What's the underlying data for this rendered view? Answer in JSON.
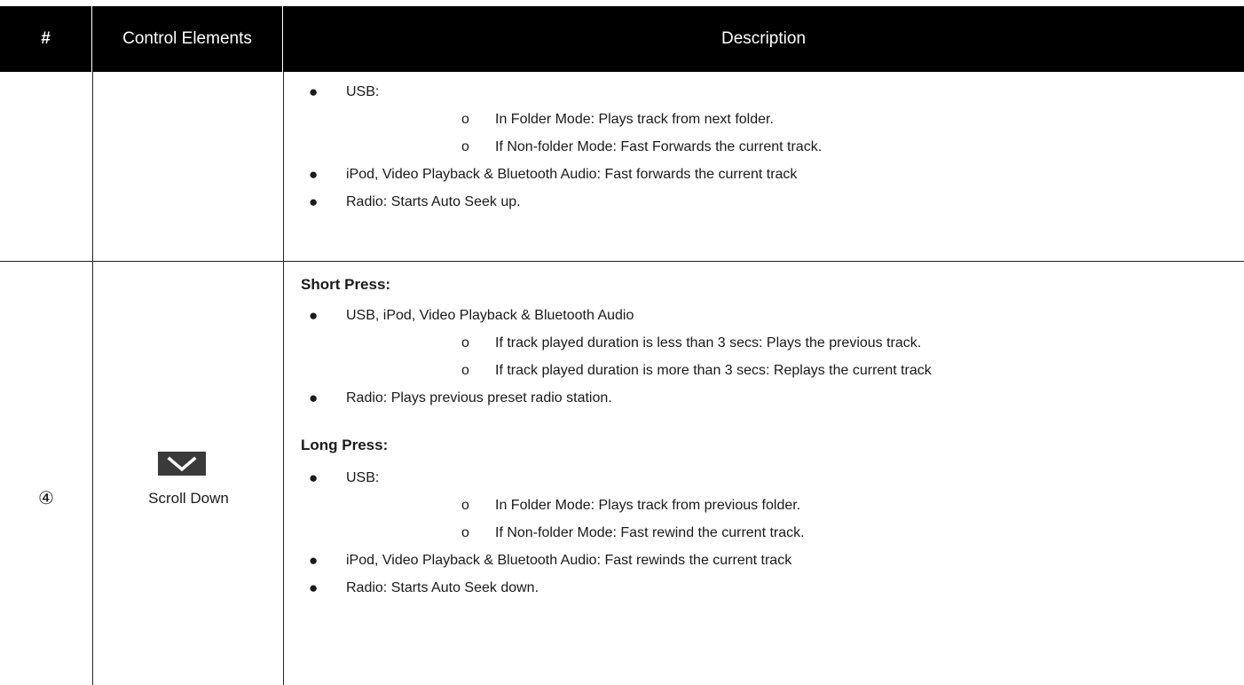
{
  "header": {
    "num": "#",
    "control": "Control Elements",
    "description": "Description"
  },
  "row1": {
    "items": [
      {
        "bullet": "●",
        "text": "USB:"
      },
      {
        "sub": "o",
        "text": "In Folder Mode: Plays track from next folder."
      },
      {
        "sub": "o",
        "text": "If Non-folder Mode: Fast Forwards the current track."
      },
      {
        "bullet": "●",
        "text": "iPod, Video Playback & Bluetooth Audio: Fast forwards the current track"
      },
      {
        "bullet": "●",
        "text": "Radio: Starts Auto Seek up."
      }
    ]
  },
  "row2": {
    "number": "④",
    "control_icon": "chevron-down-icon",
    "control_label": "Scroll Down",
    "short_press_title": "Short Press:",
    "short_press_items": [
      {
        "bullet": "●",
        "text": "USB, iPod, Video Playback & Bluetooth Audio"
      },
      {
        "sub": "o",
        "text": "If track played duration is less than 3 secs: Plays the previous track."
      },
      {
        "sub": "o",
        "text": "If track played duration is more than 3 secs: Replays the current track"
      },
      {
        "bullet": "●",
        "text": "Radio: Plays previous preset radio station."
      }
    ],
    "long_press_title": "Long Press:",
    "long_press_items": [
      {
        "bullet": "●",
        "text": "USB:"
      },
      {
        "sub": "o",
        "text": "In Folder Mode: Plays track from previous folder."
      },
      {
        "sub": "o",
        "text": "If Non-folder Mode: Fast rewind the current track."
      },
      {
        "bullet": "●",
        "text": "iPod, Video Playback & Bluetooth Audio: Fast rewinds the current track"
      },
      {
        "bullet": "●",
        "text": "Radio: Starts Auto Seek down."
      }
    ]
  },
  "colors": {
    "header_bg": "#000000",
    "header_text": "#ffffff",
    "button_bg": "#3a3a3a"
  }
}
